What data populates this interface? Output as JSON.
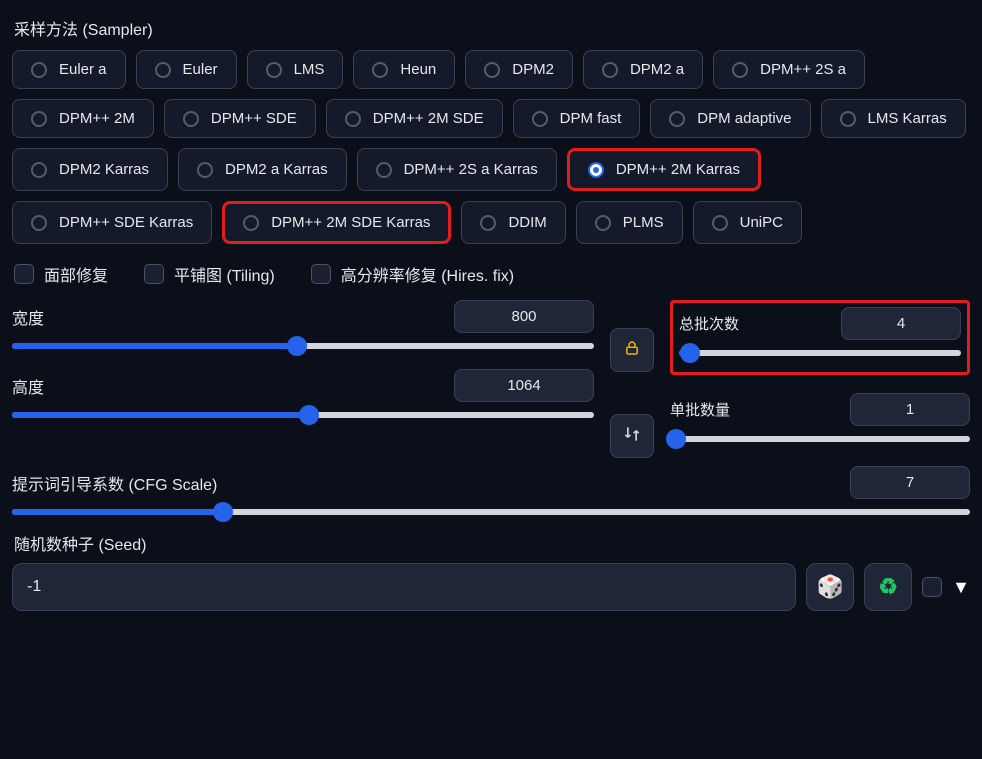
{
  "sampler": {
    "label": "采样方法 (Sampler)",
    "options": [
      "Euler a",
      "Euler",
      "LMS",
      "Heun",
      "DPM2",
      "DPM2 a",
      "DPM++ 2S a",
      "DPM++ 2M",
      "DPM++ SDE",
      "DPM++ 2M SDE",
      "DPM fast",
      "DPM adaptive",
      "LMS Karras",
      "DPM2 Karras",
      "DPM2 a Karras",
      "DPM++ 2S a Karras",
      "DPM++ 2M Karras",
      "DPM++ SDE Karras",
      "DPM++ 2M SDE Karras",
      "DDIM",
      "PLMS",
      "UniPC"
    ],
    "selected": "DPM++ 2M Karras",
    "highlighted": [
      "DPM++ 2M Karras",
      "DPM++ 2M SDE Karras"
    ]
  },
  "checks": {
    "face_restore": "面部修复",
    "tiling": "平铺图 (Tiling)",
    "hires_fix": "高分辨率修复 (Hires. fix)"
  },
  "width": {
    "label": "宽度",
    "value": "800",
    "percent": 49
  },
  "height": {
    "label": "高度",
    "value": "1064",
    "percent": 51
  },
  "batch_count": {
    "label": "总批次数",
    "value": "4",
    "percent": 4
  },
  "batch_size": {
    "label": "单批数量",
    "value": "1",
    "percent": 2
  },
  "cfg": {
    "label": "提示词引导系数 (CFG Scale)",
    "value": "7",
    "percent": 22
  },
  "seed": {
    "label": "随机数种子 (Seed)",
    "value": "-1"
  },
  "icons": {
    "lock": "lock-icon",
    "swap": "swap-icon",
    "dice": "🎲",
    "recycle": "♻",
    "caret": "▼"
  }
}
